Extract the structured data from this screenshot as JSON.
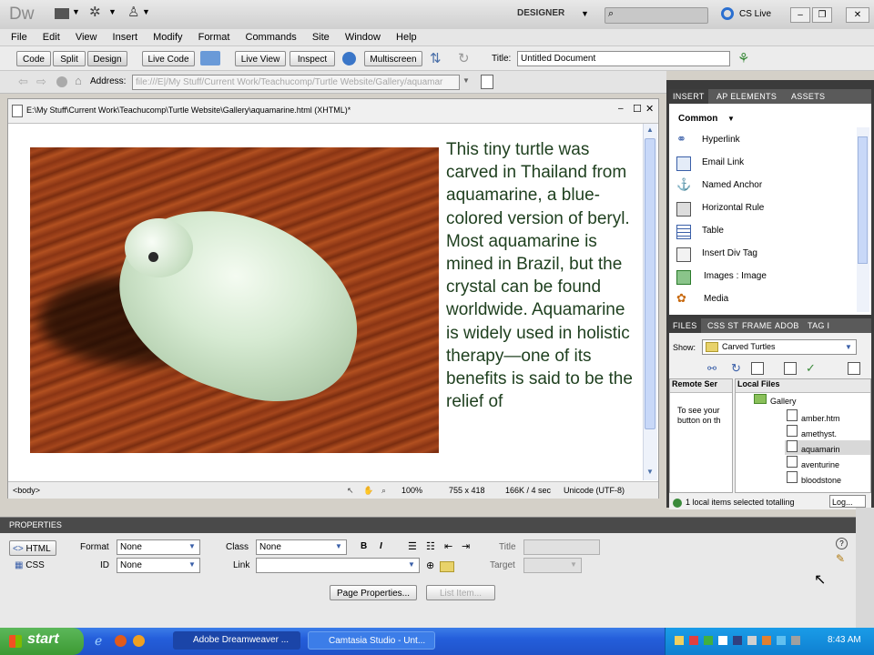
{
  "app": {
    "logo": "Dw",
    "workspace": "DESIGNER",
    "cs_live": "CS Live",
    "menu": [
      "File",
      "Edit",
      "View",
      "Insert",
      "Modify",
      "Format",
      "Commands",
      "Site",
      "Window",
      "Help"
    ]
  },
  "doc_toolbar": {
    "code": "Code",
    "split": "Split",
    "design": "Design",
    "live_code": "Live Code",
    "live_view": "Live View",
    "inspect": "Inspect",
    "multiscreen": "Multiscreen",
    "title_label": "Title:",
    "title_value": "Untitled Document"
  },
  "address_bar": {
    "label": "Address:",
    "value": "file:///E|/My Stuff/Current Work/Teachucomp/Turtle Website/Gallery/aquamar"
  },
  "document": {
    "path": "E:\\My Stuff\\Current Work\\Teachucomp\\Turtle Website\\Gallery\\aquamarine.html (XHTML)*",
    "body_text": "This tiny turtle was carved in Thailand from aquamarine, a blue-colored version of beryl.  Most aquamarine is mined in Brazil, but the crystal can be found worldwide. Aquamarine is widely used in holistic therapy—one of its benefits is said to be the relief of",
    "status": {
      "tag": "<body>",
      "zoom": "100%",
      "size": "755 x 418",
      "weight": "166K / 4 sec",
      "encoding": "Unicode (UTF-8)"
    }
  },
  "insert_panel": {
    "tabs": [
      "INSERT",
      "AP ELEMENTS",
      "ASSETS"
    ],
    "category": "Common",
    "items": [
      "Hyperlink",
      "Email Link",
      "Named Anchor",
      "Horizontal Rule",
      "Table",
      "Insert Div Tag",
      "Images : Image",
      "Media"
    ]
  },
  "files_panel": {
    "tabs": [
      "FILES",
      "CSS ST",
      "FRAME",
      "ADOB",
      "TAG I"
    ],
    "show_label": "Show:",
    "site": "Carved Turtles",
    "remote_header": "Remote Ser",
    "local_header": "Local Files",
    "remote_text": "To see your button on th",
    "tree": [
      "Gallery",
      "amber.htm",
      "amethyst.",
      "aquamarin",
      "aventurine",
      "bloodstone"
    ],
    "status": "1 local items selected totalling",
    "log_button": "Log..."
  },
  "properties": {
    "title": "PROPERTIES",
    "html_btn": "HTML",
    "css_btn": "CSS",
    "format_label": "Format",
    "format_value": "None",
    "class_label": "Class",
    "class_value": "None",
    "id_label": "ID",
    "id_value": "None",
    "link_label": "Link",
    "title_label": "Title",
    "target_label": "Target",
    "page_props": "Page Properties...",
    "list_item": "List Item...",
    "bold": "B",
    "italic": "I"
  },
  "taskbar": {
    "start": "start",
    "tasks": [
      "Adobe Dreamweaver ...",
      "Camtasia Studio - Unt..."
    ],
    "clock": "8:43 AM"
  },
  "colors": {
    "panel_dark": "#3b3b3b",
    "tab_bar": "#5a5a5a",
    "body_text": "#1e3f1e",
    "taskbar_blue": "#245edb",
    "start_green": "#3c9a33",
    "scroll_blue": "#c8d8f8"
  }
}
